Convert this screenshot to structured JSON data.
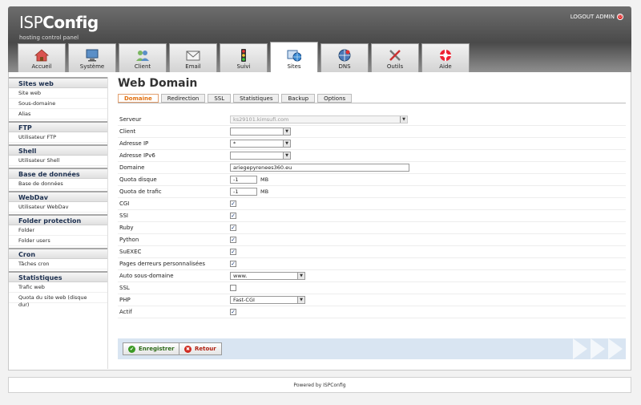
{
  "header": {
    "logo_light": "ISP",
    "logo_bold": "Config",
    "tagline": "hosting control panel",
    "logout_label": "LOGOUT ADMIN"
  },
  "tabs": [
    {
      "label": "Accueil",
      "icon": "house-icon",
      "active": false
    },
    {
      "label": "Système",
      "icon": "computer-icon",
      "active": false
    },
    {
      "label": "Client",
      "icon": "users-icon",
      "active": false
    },
    {
      "label": "Email",
      "icon": "envelope-icon",
      "active": false
    },
    {
      "label": "Suivi",
      "icon": "traffic-light-icon",
      "active": false
    },
    {
      "label": "Sites",
      "icon": "sites-icon",
      "active": true
    },
    {
      "label": "DNS",
      "icon": "dns-icon",
      "active": false
    },
    {
      "label": "Outils",
      "icon": "tools-icon",
      "active": false
    },
    {
      "label": "Aide",
      "icon": "lifebuoy-icon",
      "active": false
    }
  ],
  "sidebar": [
    {
      "title": "Sites web",
      "items": [
        "Site web",
        "Sous-domaine",
        "Alias"
      ]
    },
    {
      "title": "FTP",
      "items": [
        "Utilisateur FTP"
      ]
    },
    {
      "title": "Shell",
      "items": [
        "Utilisateur Shell"
      ]
    },
    {
      "title": "Base de données",
      "items": [
        "Base de données"
      ]
    },
    {
      "title": "WebDav",
      "items": [
        "Utilisateur WebDav"
      ]
    },
    {
      "title": "Folder protection",
      "items": [
        "Folder",
        "Folder users"
      ]
    },
    {
      "title": "Cron",
      "items": [
        "Tâches cron"
      ]
    },
    {
      "title": "Statistiques",
      "items": [
        "Trafic web",
        "Quota du site web (disque dur)"
      ]
    }
  ],
  "page": {
    "title": "Web Domain",
    "subtabs": [
      "Domaine",
      "Redirection",
      "SSL",
      "Statistiques",
      "Backup",
      "Options"
    ],
    "active_subtab": "Domaine"
  },
  "form": {
    "serveur": {
      "label": "Serveur",
      "value": "ks29101.kimsufi.com"
    },
    "client": {
      "label": "Client",
      "value": ""
    },
    "adresse_ip": {
      "label": "Adresse IP",
      "value": "*"
    },
    "adresse_ipv6": {
      "label": "Adresse IPv6",
      "value": ""
    },
    "domaine": {
      "label": "Domaine",
      "value": "ariegepyrenees360.eu"
    },
    "quota_disque": {
      "label": "Quota disque",
      "value": "-1",
      "unit": "MB"
    },
    "quota_trafic": {
      "label": "Quota de trafic",
      "value": "-1",
      "unit": "MB"
    },
    "cgi": {
      "label": "CGI",
      "checked": true
    },
    "ssi": {
      "label": "SSI",
      "checked": true
    },
    "ruby": {
      "label": "Ruby",
      "checked": true
    },
    "python": {
      "label": "Python",
      "checked": true
    },
    "suexec": {
      "label": "SuEXEC",
      "checked": true
    },
    "pages_erreurs": {
      "label": "Pages derreurs personnalisées",
      "checked": true
    },
    "auto_sous_domaine": {
      "label": "Auto sous-domaine",
      "value": "www."
    },
    "ssl": {
      "label": "SSL",
      "checked": false
    },
    "php": {
      "label": "PHP",
      "value": "Fast-CGI"
    },
    "actif": {
      "label": "Actif",
      "checked": true
    }
  },
  "buttons": {
    "save_label": "Enregistrer",
    "cancel_label": "Retour"
  },
  "footer": {
    "prefix": "Powered by ",
    "brand": "ISPConfig"
  },
  "colors": {
    "active_subtab": "#e2700f",
    "sidebar_heading": "#1c2f4f",
    "button_bar": "#d9e5f2"
  }
}
